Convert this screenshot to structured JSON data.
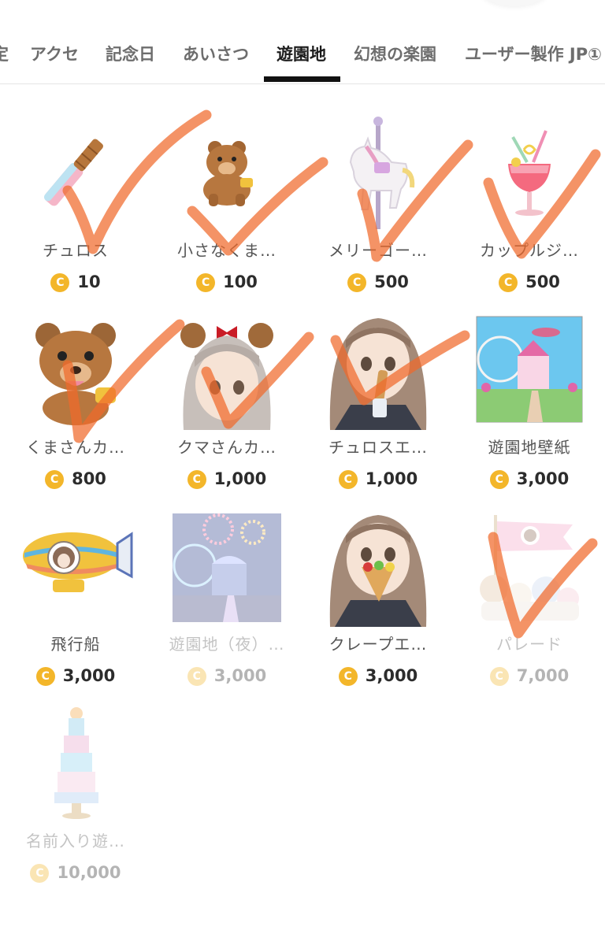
{
  "tabs": [
    {
      "label": "定"
    },
    {
      "label": "アクセ"
    },
    {
      "label": "記念日"
    },
    {
      "label": "あいさつ"
    },
    {
      "label": "遊園地",
      "active": true
    },
    {
      "label": "幻想の楽園"
    },
    {
      "label": "ユーザー製作 JP①"
    }
  ],
  "coin_symbol": "C",
  "coin_color": "#f3b62a",
  "check_color": "#f06a2b",
  "items": [
    {
      "name": "チュロス",
      "price": "10",
      "icon": "churro-icon",
      "checked": true
    },
    {
      "name": "小さなくま…",
      "price": "100",
      "icon": "small-bear-icon",
      "checked": true
    },
    {
      "name": "メリーゴー…",
      "price": "500",
      "icon": "carousel-horse-icon",
      "checked": true
    },
    {
      "name": "カップルジ…",
      "price": "500",
      "icon": "couple-drink-icon",
      "checked": true
    },
    {
      "name": "くまさんカ…",
      "price": "800",
      "icon": "bear-headband-icon",
      "checked": true
    },
    {
      "name": "クマさんカ…",
      "price": "1,000",
      "icon": "bear-ears-avatar-icon",
      "checked": true
    },
    {
      "name": "チュロスエ…",
      "price": "1,000",
      "icon": "churro-avatar-icon",
      "checked": true
    },
    {
      "name": "遊園地壁紙",
      "price": "3,000",
      "icon": "amusement-park-wallpaper-icon",
      "checked": false
    },
    {
      "name": "飛行船",
      "price": "3,000",
      "icon": "airship-icon",
      "checked": false
    },
    {
      "name": "遊園地（夜）…",
      "price": "3,000",
      "icon": "night-park-wallpaper-icon",
      "checked": false,
      "dim": true
    },
    {
      "name": "クレープエ…",
      "price": "3,000",
      "icon": "crepe-avatar-icon",
      "checked": false
    },
    {
      "name": "パレード",
      "price": "7,000",
      "icon": "parade-icon",
      "checked": true,
      "dim": true
    },
    {
      "name": "名前入り遊…",
      "price": "10,000",
      "icon": "named-tower-icon",
      "checked": false,
      "dim": true
    }
  ]
}
